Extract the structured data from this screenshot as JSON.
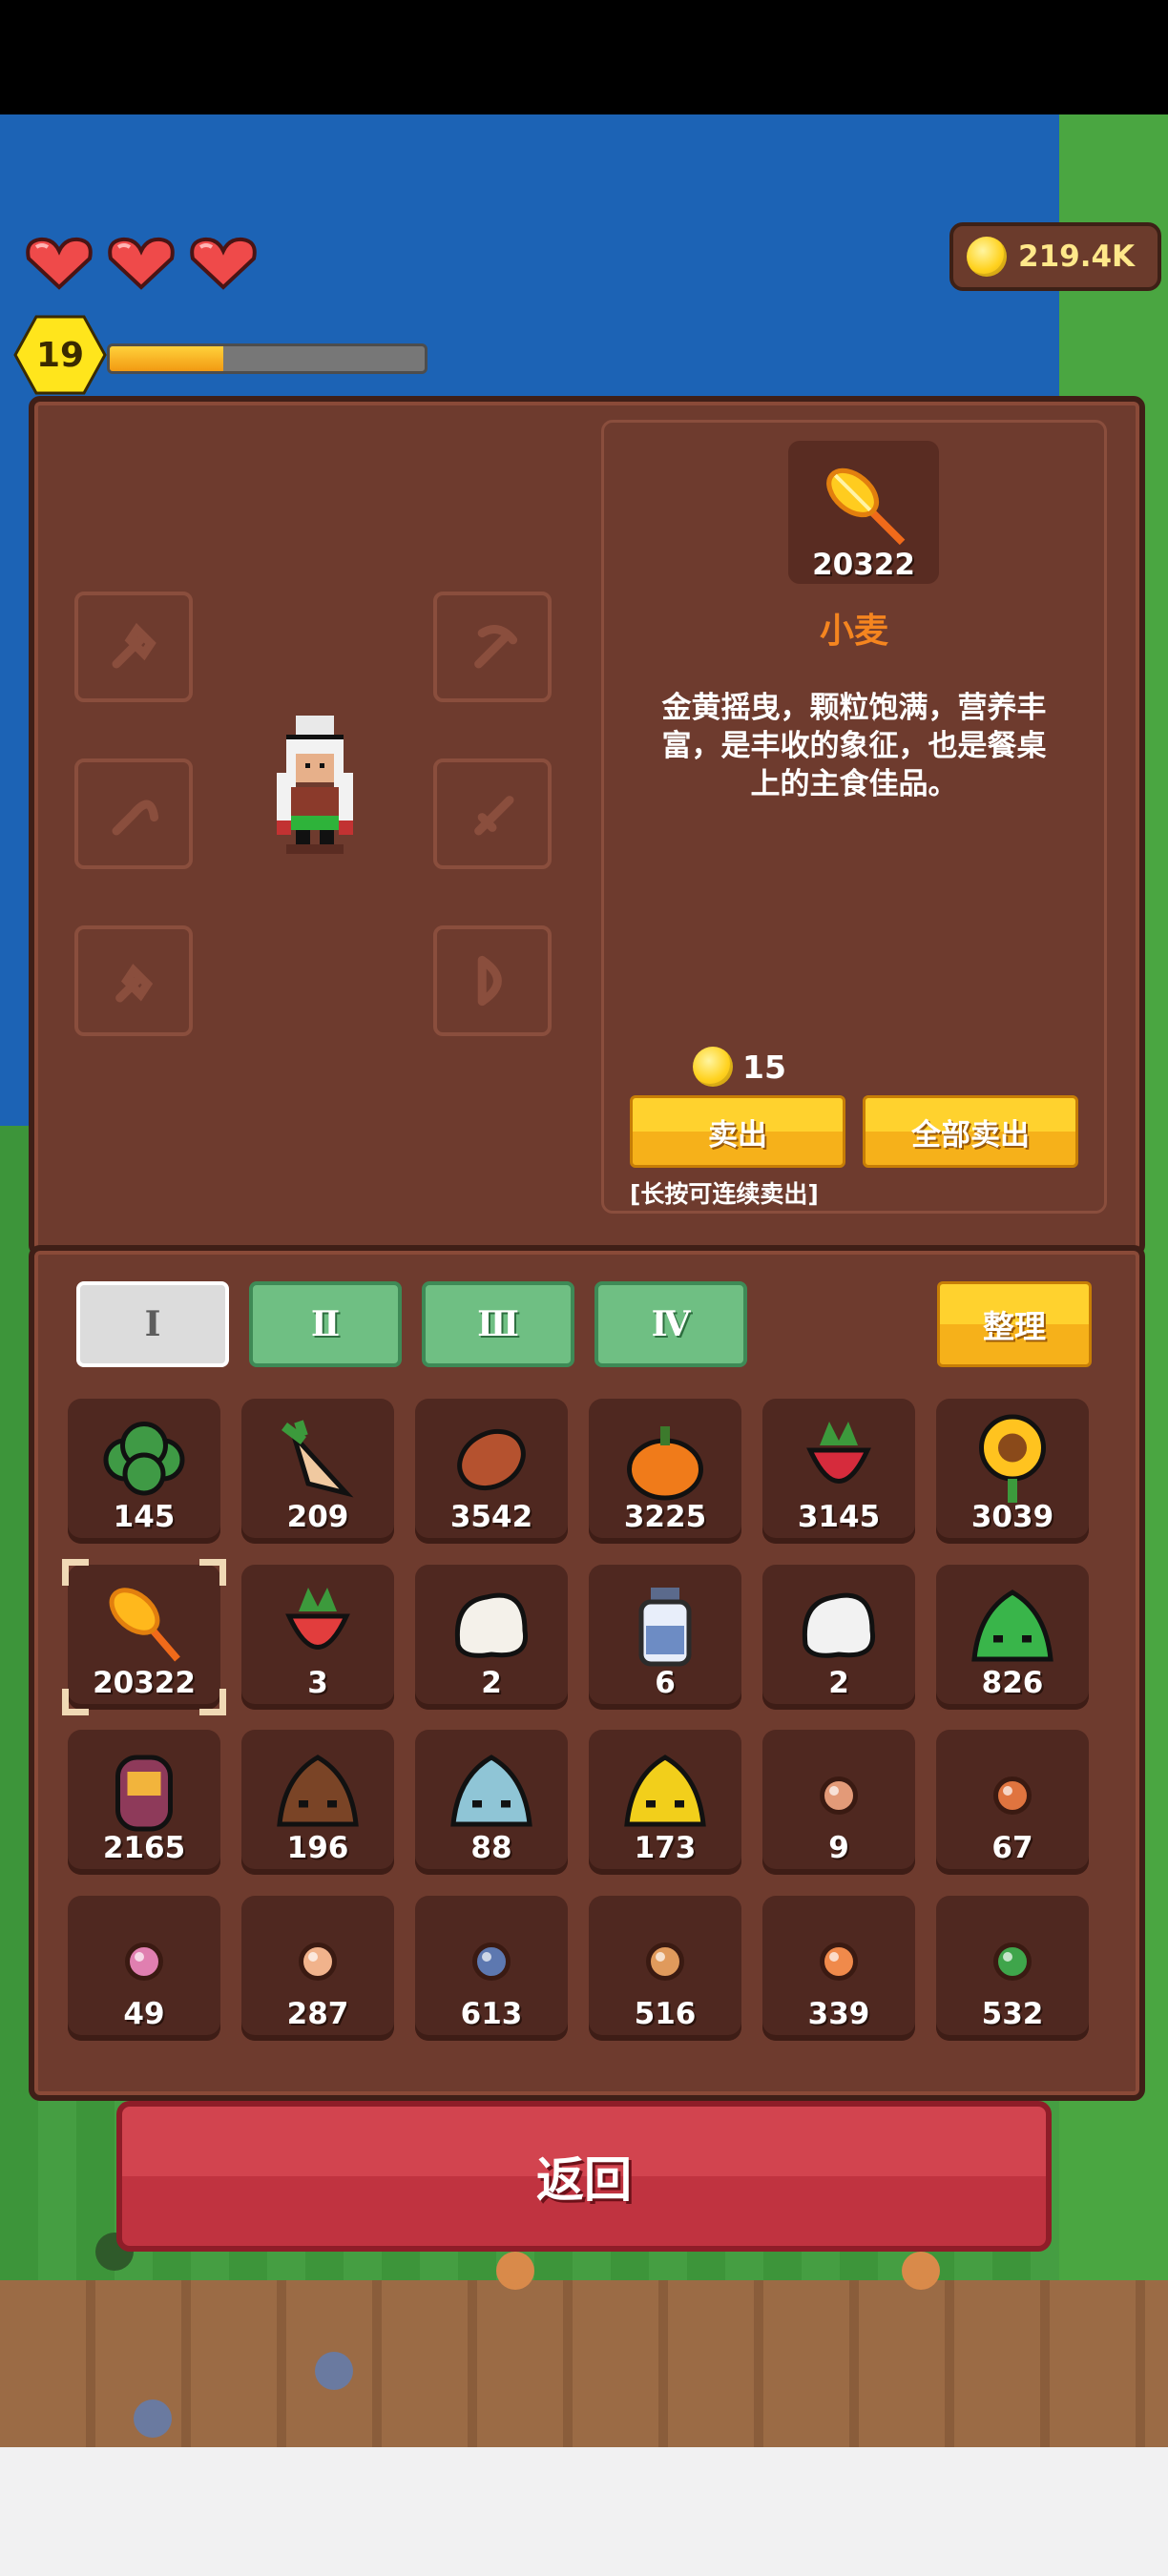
{
  "hud": {
    "hearts": 3,
    "level": "19",
    "xp_fraction": 0.36,
    "coins": "219.4K"
  },
  "equipment": {
    "slots": [
      "axe-icon",
      "pickaxe-icon",
      "sickle-icon",
      "sword-icon",
      "shovel-icon",
      "bow-icon"
    ]
  },
  "detail": {
    "count": "20322",
    "name": "小麦",
    "description": "金黄摇曳，颗粒饱满，营养丰富，是丰收的象征，也是餐桌上的主食佳品。",
    "price": "15",
    "sell_label": "卖出",
    "sell_all_label": "全部卖出",
    "hint": "[长按可连续卖出]"
  },
  "tabs": [
    {
      "label": "Ⅰ",
      "active": true
    },
    {
      "label": "Ⅱ",
      "active": false
    },
    {
      "label": "Ⅲ",
      "active": false
    },
    {
      "label": "Ⅳ",
      "active": false
    }
  ],
  "sort_label": "整理",
  "items": [
    {
      "icon": "broccoli-icon",
      "count": "145",
      "color": "#3f9a45"
    },
    {
      "icon": "carrot-icon",
      "count": "209",
      "color": "#f0c9a0"
    },
    {
      "icon": "potato-icon",
      "count": "3542",
      "color": "#b5522f"
    },
    {
      "icon": "pumpkin-icon",
      "count": "3225",
      "color": "#f07b1a"
    },
    {
      "icon": "radish-icon",
      "count": "3145",
      "color": "#d62b3c"
    },
    {
      "icon": "sunflower-icon",
      "count": "3039",
      "color": "#ffc31f"
    },
    {
      "icon": "wheat-icon",
      "count": "20322",
      "color": "#ffb81c",
      "selected": true
    },
    {
      "icon": "strawberry-icon",
      "count": "3",
      "color": "#e23d3d"
    },
    {
      "icon": "wool-icon",
      "count": "2",
      "color": "#f4f1ea"
    },
    {
      "icon": "milk-bottle-icon",
      "count": "6",
      "color": "#e8eefa"
    },
    {
      "icon": "feather-icon",
      "count": "2",
      "color": "#f2f2f2"
    },
    {
      "icon": "green-slime-icon",
      "count": "826",
      "color": "#39b54a"
    },
    {
      "icon": "honey-jar-icon",
      "count": "2165",
      "color": "#8e3a5a"
    },
    {
      "icon": "brown-slime-icon",
      "count": "196",
      "color": "#7a4426"
    },
    {
      "icon": "blue-slime-icon",
      "count": "88",
      "color": "#8fc5d6"
    },
    {
      "icon": "yellow-slime-icon",
      "count": "173",
      "color": "#f2cf1b"
    },
    {
      "icon": "seed-pink-icon",
      "count": "9",
      "color": "#e39a78"
    },
    {
      "icon": "seed-orange-icon",
      "count": "67",
      "color": "#e0743f"
    },
    {
      "icon": "seed-magenta-icon",
      "count": "49",
      "color": "#e07fb0"
    },
    {
      "icon": "seed-peach-icon",
      "count": "287",
      "color": "#f1b38c"
    },
    {
      "icon": "seed-blue-icon",
      "count": "613",
      "color": "#5d78b0"
    },
    {
      "icon": "seed-tan-icon",
      "count": "516",
      "color": "#e09a5c"
    },
    {
      "icon": "seed-coral-icon",
      "count": "339",
      "color": "#f08a4b"
    },
    {
      "icon": "seed-green-icon",
      "count": "532",
      "color": "#3fa54b"
    }
  ],
  "back_label": "返回"
}
